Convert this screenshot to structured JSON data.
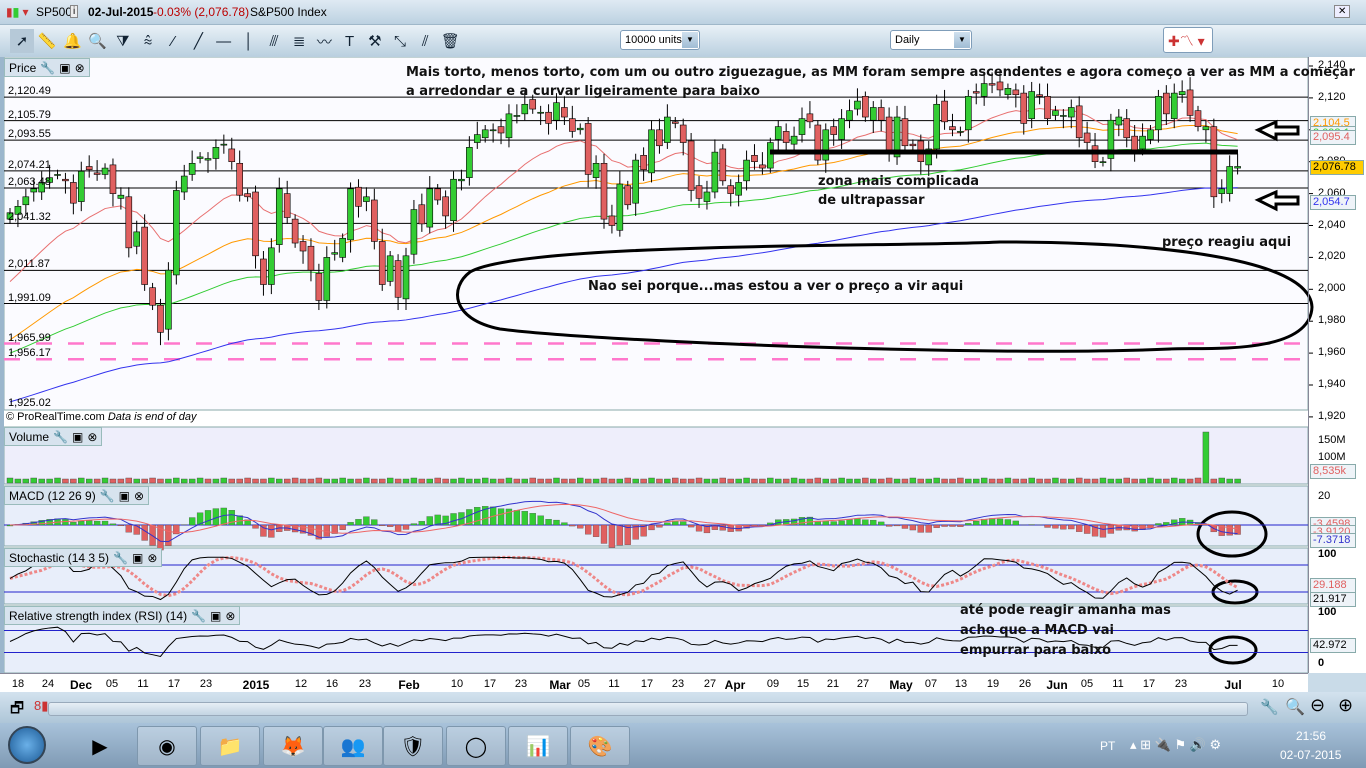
{
  "window": {
    "symbol": "SP500",
    "date": "02-Jul-2015",
    "change": "-0.03% (2,076.78)",
    "name": "S&P500 Index"
  },
  "toolbar": {
    "tools": [
      "pointer-icon",
      "ruler-icon",
      "alarm-bell-icon",
      "zoom-magnifier-icon",
      "triangle-pattern-icon",
      "channel-icon",
      "segment-icon",
      "line-icon",
      "horizontal-line-icon",
      "vertical-line-icon",
      "fan-icon",
      "fibonacci-icon",
      "trend-icon",
      "text-icon",
      "tools-icon",
      "arrow-line-icon",
      "parallel-line-icon",
      "trash-icon"
    ],
    "units": "10000 units",
    "period": "Daily"
  },
  "price_panel": {
    "title": "Price",
    "copyright": "© ProRealTime.com",
    "data_note": "Data is end of day",
    "axis_ticks": [
      2140,
      2120,
      2100,
      2080,
      2060,
      2040,
      2020,
      2000,
      1980,
      1960,
      1940,
      1920
    ],
    "levels": [
      {
        "v": 2120.49,
        "label": "2,120.49"
      },
      {
        "v": 2105.79,
        "label": "2,105.79"
      },
      {
        "v": 2093.55,
        "label": "2,093.55"
      },
      {
        "v": 2074.21,
        "label": "2,074.21"
      },
      {
        "v": 2063.48,
        "label": "2,063.48"
      },
      {
        "v": 2041.32,
        "label": "2,041.32"
      },
      {
        "v": 2011.87,
        "label": "2,011.87"
      },
      {
        "v": 1991.09,
        "label": "1,991.09"
      },
      {
        "v": 1965.99,
        "label": "1,965.99",
        "dashed": true
      },
      {
        "v": 1956.17,
        "label": "1,956.17",
        "dashed": true
      },
      {
        "v": 1925.02,
        "label": "1,925.02",
        "noline": true
      }
    ],
    "tags": [
      {
        "label": "2,104.5",
        "color": "#ff9900"
      },
      {
        "label": "2,098.1",
        "color": "#33cc33"
      },
      {
        "label": "2,095.4",
        "color": "#e06060"
      },
      {
        "label": "2,076.78",
        "color": "#000",
        "bg": "#ffcc00"
      },
      {
        "label": "2,054.7",
        "color": "#3333ee"
      }
    ],
    "closes": [
      2048,
      2052,
      2058,
      2063,
      2067,
      2070,
      2072,
      2068,
      2054,
      2074,
      2075,
      2072,
      2076,
      2060,
      2059,
      2026,
      2036,
      2003,
      1990,
      1973,
      2012,
      2062,
      2071,
      2079,
      2083,
      2082,
      2089,
      2091,
      2080,
      2059,
      2058,
      2021,
      2003,
      2026,
      2063,
      2045,
      2029,
      2024,
      2012,
      1993,
      2020,
      2023,
      2032,
      2063,
      2052,
      2058,
      2030,
      2003,
      2021,
      1995,
      2021,
      2050,
      2041,
      2063,
      2056,
      2046,
      2069,
      2069,
      2089,
      2097,
      2100,
      2100,
      2098,
      2110,
      2109,
      2116,
      2113,
      2111,
      2104,
      2117,
      2108,
      2099,
      2101,
      2072,
      2079,
      2044,
      2040,
      2066,
      2053,
      2081,
      2075,
      2100,
      2090,
      2108,
      2104,
      2092,
      2062,
      2057,
      2061,
      2086,
      2068,
      2060,
      2067,
      2081,
      2080,
      2076,
      2092,
      2102,
      2092,
      2096,
      2107,
      2105,
      2081,
      2100,
      2097,
      2107,
      2112,
      2118,
      2108,
      2114,
      2106,
      2086,
      2108,
      2090,
      2090,
      2080,
      2088,
      2116,
      2105,
      2100,
      2099,
      2121,
      2123,
      2129,
      2128,
      2125,
      2126,
      2122,
      2104,
      2124,
      2121,
      2107,
      2112,
      2109,
      2114,
      2095,
      2092,
      2080,
      2080,
      2106,
      2108,
      2095,
      2085,
      2096,
      2100,
      2121,
      2110,
      2123,
      2124,
      2109,
      2102,
      2102,
      2058,
      2063,
      2077,
      2077
    ],
    "moving_averages": [
      {
        "color": "#e87070",
        "start": 2000,
        "k": 0.1
      },
      {
        "color": "#ff9900",
        "start": 1965,
        "k": 0.04
      },
      {
        "color": "#33cc33",
        "start": 1958,
        "k": 0.022
      },
      {
        "color": "#3333ee",
        "start": 1928,
        "k": 0.012
      }
    ],
    "up_color": "#33cc33",
    "down_color": "#e06060"
  },
  "volume": {
    "title": "Volume",
    "ticks": [
      "150M",
      "100M"
    ],
    "tag": "8,535k"
  },
  "macd": {
    "title": "MACD (12 26 9)",
    "tick": "20",
    "tags": [
      "-3.4598",
      "-3.9120",
      "-7.3718"
    ]
  },
  "stochastic": {
    "title": "Stochastic (14 3 5)",
    "ticks": [
      "100"
    ],
    "tags": [
      "29.188",
      "21.917"
    ]
  },
  "rsi": {
    "title": "Relative strength index (RSI) (14)",
    "ticks": [
      "100",
      "0"
    ],
    "tag": "42.972"
  },
  "annotations": {
    "top": "Mais torto, menos torto, com um ou outro ziguezague, as MM foram sempre ascendentes e agora começo a ver as MM a começar",
    "top2": "a arredondar e a curvar ligeiramente para baixo",
    "zona1": "zona mais complicada",
    "zona2": "de ultrapassar",
    "preco": "preço reagiu aqui",
    "nao_sei": "Nao sei porque...mas estou a ver o preço a vir aqui",
    "rsi1": "até pode reagir amanha mas",
    "rsi2": "acho que a MACD vai",
    "rsi3": "empurrar para baixo"
  },
  "dates": [
    "18",
    "24",
    "Dec",
    "05",
    "11",
    "17",
    "23",
    "2015",
    "12",
    "16",
    "23",
    "Feb",
    "10",
    "17",
    "23",
    "Mar",
    "05",
    "11",
    "17",
    "23",
    "27",
    "Apr",
    "09",
    "15",
    "21",
    "27",
    "May",
    "07",
    "13",
    "19",
    "26",
    "Jun",
    "05",
    "11",
    "17",
    "23",
    "Jul",
    "10"
  ],
  "taskbar": {
    "apps": [
      "media-player-icon",
      "chrome-icon",
      "file-explorer-icon",
      "firefox-icon",
      "messenger-icon",
      "mcafee-icon",
      "app-circle-icon",
      "prorealtime-icon",
      "paint-icon"
    ],
    "lang": "PT",
    "time": "21:56",
    "date": "02-07-2015"
  }
}
